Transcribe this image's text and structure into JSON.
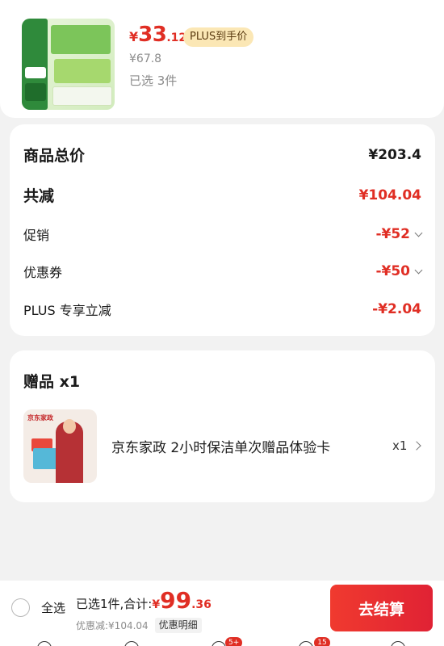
{
  "product": {
    "price_symbol": "¥",
    "price_integer": "33",
    "price_decimal": ".12",
    "plus_badge": "PLUS到手价",
    "original_price": "¥67.8",
    "selected_count": "已选 3件"
  },
  "summary": {
    "total_label": "商品总价",
    "total_value": "¥203.4",
    "reduced_label": "共减",
    "reduced_value": "¥104.04",
    "promo_label": "促销",
    "promo_value": "-¥52",
    "coupon_label": "优惠券",
    "coupon_value": "-¥50",
    "plus_label": "PLUS 专享立减",
    "plus_value": "-¥2.04"
  },
  "gift": {
    "title": "赠品 x1",
    "name": "京东家政 2小时保洁单次赠品体验卡",
    "quantity": "x1",
    "image_logo": "京东家政"
  },
  "bottom_bar": {
    "select_all": "全选",
    "total_label": "已选1件,合计:",
    "total_symbol": "¥",
    "total_integer": "99",
    "total_decimal": ".36",
    "discount_text": "优惠减:¥104.04",
    "detail_button": "优惠明细",
    "checkout_button": "去结算"
  },
  "tab_bar": {
    "badge_1": "5+",
    "badge_2": "15"
  },
  "colors": {
    "accent_red": "#e02e24",
    "plus_tag_bg": "#fbe7b5",
    "page_bg": "#f2f2f2"
  }
}
